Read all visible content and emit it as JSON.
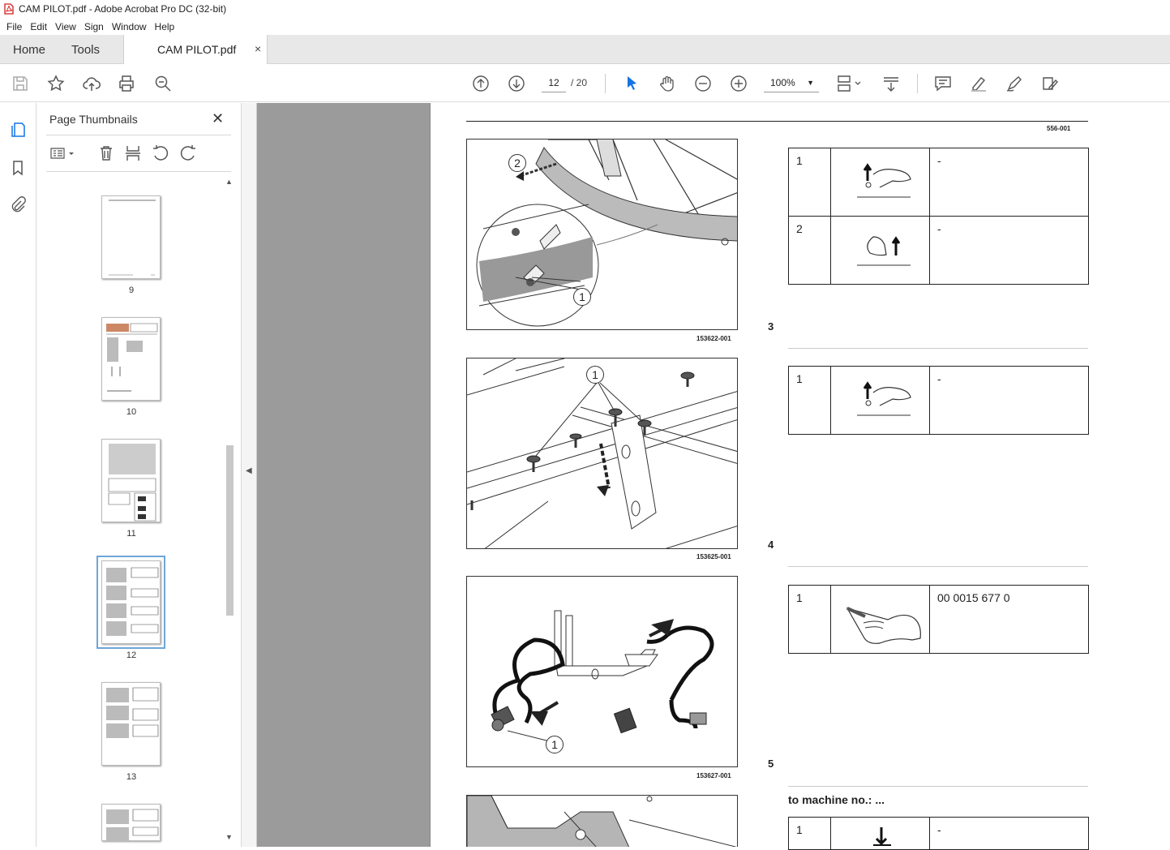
{
  "window": {
    "title": "CAM PILOT.pdf - Adobe Acrobat Pro DC (32-bit)"
  },
  "menu": [
    "File",
    "Edit",
    "View",
    "Sign",
    "Window",
    "Help"
  ],
  "tabs": {
    "home": "Home",
    "tools": "Tools",
    "document": "CAM PILOT.pdf",
    "close": "×"
  },
  "toolbar": {
    "page_current": "12",
    "page_total": "/ 20",
    "zoom": "100%"
  },
  "sidebar": {
    "title": "Page Thumbnails",
    "close": "✕",
    "thumbnails": [
      {
        "label": "9"
      },
      {
        "label": "10"
      },
      {
        "label": "11"
      },
      {
        "label": "12",
        "selected": true
      },
      {
        "label": "13"
      },
      {
        "label": ""
      }
    ]
  },
  "page": {
    "doc_code": "556-001",
    "figures": [
      {
        "code": "153622-001"
      },
      {
        "code": "153625-001"
      },
      {
        "code": "153627-001"
      }
    ],
    "step_numbers": [
      "3",
      "4",
      "5"
    ],
    "tables": [
      {
        "rows": [
          {
            "num": "1",
            "icon": "wrench-up-icon",
            "text": "-"
          },
          {
            "num": "2",
            "icon": "hand-up-icon",
            "text": "-"
          }
        ]
      },
      {
        "rows": [
          {
            "num": "1",
            "icon": "wrench-up-icon",
            "text": "-"
          }
        ]
      },
      {
        "rows": [
          {
            "num": "1",
            "icon": "hand-holding-part-icon",
            "text": "00 0015 677 0"
          }
        ]
      },
      {
        "rows": [
          {
            "num": "1",
            "icon": "press-down-icon",
            "text": "-"
          }
        ]
      }
    ],
    "machine_note": "to machine no.: ..."
  },
  "callouts": [
    "1",
    "2"
  ]
}
